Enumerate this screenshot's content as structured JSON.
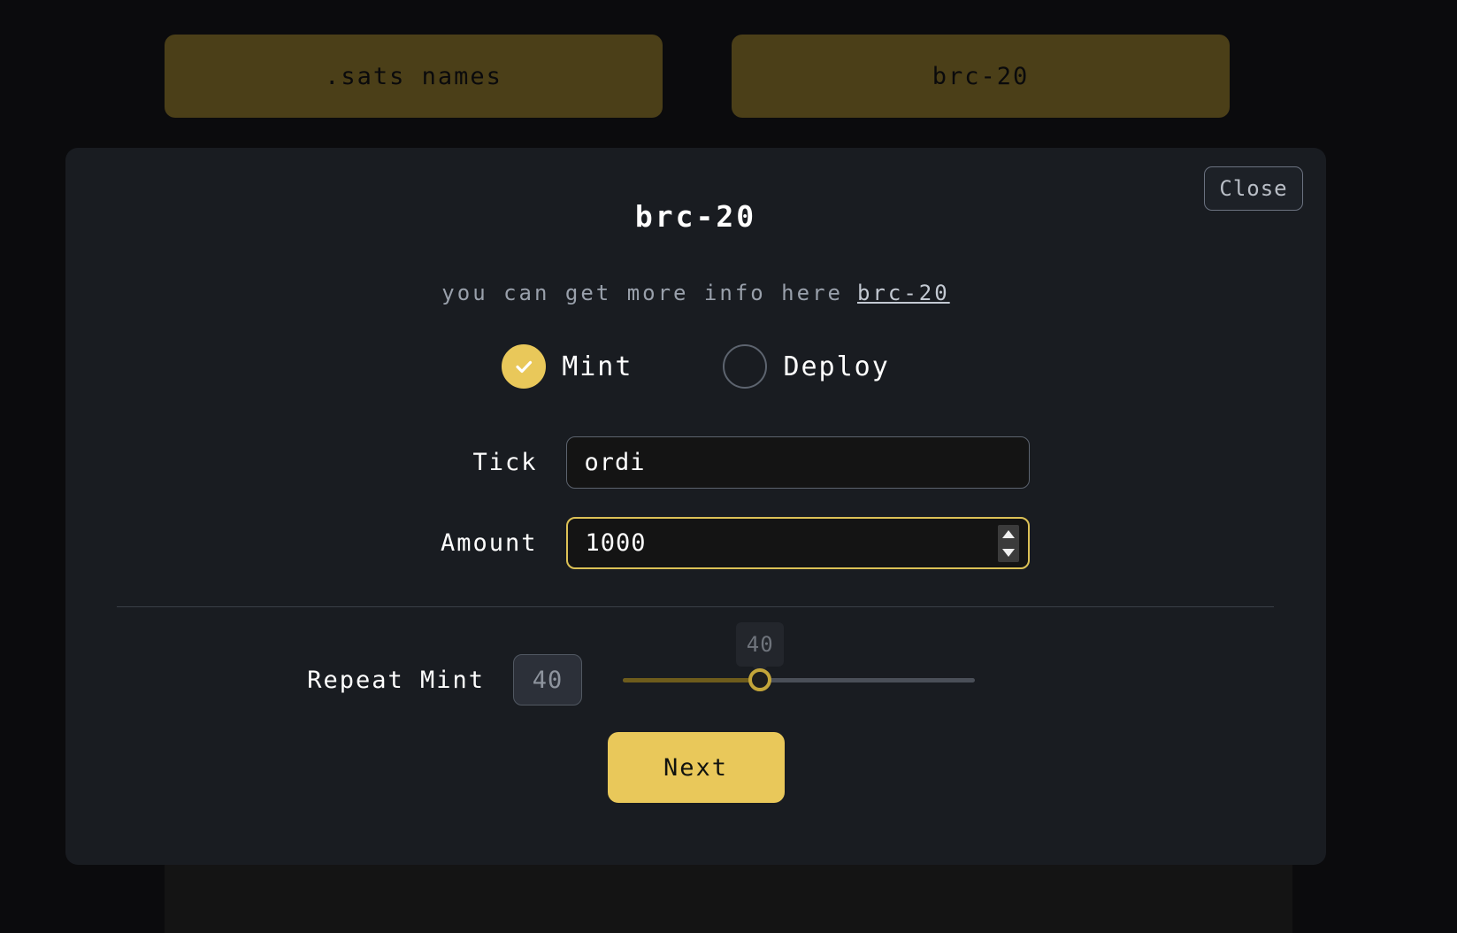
{
  "tabs": [
    {
      "label": ".sats names",
      "name": "tab-sats-names"
    },
    {
      "label": "brc-20",
      "name": "tab-brc-20"
    }
  ],
  "modal": {
    "title": "brc-20",
    "close_label": "Close",
    "info": {
      "text": "you can get more info here",
      "link_label": "brc-20"
    },
    "mode_options": [
      {
        "label": "Mint",
        "selected": true
      },
      {
        "label": "Deploy",
        "selected": false
      }
    ],
    "fields": {
      "tick": {
        "label": "Tick",
        "value": "ordi",
        "placeholder": "ordi"
      },
      "amount": {
        "label": "Amount",
        "value": "1000",
        "placeholder": "1000",
        "spinner_up_icon": "chevron-up-icon",
        "spinner_down_icon": "chevron-down-icon"
      }
    },
    "repeat_mint": {
      "label": "Repeat Mint",
      "value": "40",
      "slider_value": "40",
      "slider_min": "1",
      "slider_max": "100",
      "tooltip": "40"
    },
    "next_label": "Next"
  },
  "colors": {
    "accent_gold": "#e9c85a",
    "tab_bg": "#4b3f18",
    "modal_bg": "#191c21",
    "page_bg": "#0b0b0d",
    "field_bg": "#141414",
    "muted_text": "#99a0ab"
  }
}
